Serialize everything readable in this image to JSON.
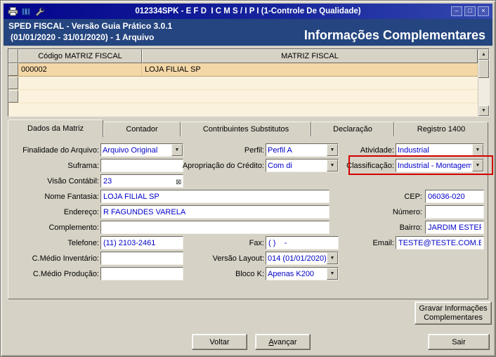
{
  "window": {
    "title": "012334SPK - E F D  I C M S / I P I (1-Controle De Qualidade)",
    "controls": {
      "minimize": "–",
      "maximize": "□",
      "close": "×"
    }
  },
  "header": {
    "line1": "SPED FISCAL - Versão Guia Prático 3.0.1",
    "line2": "(01/01/2020 - 31/01/2020) - 1 Arquivo",
    "right_title": "Informações Complementares"
  },
  "grid": {
    "columns": [
      "Código MATRIZ FISCAL",
      "MATRIZ FISCAL"
    ],
    "rows": [
      {
        "codigo": "000002",
        "matriz": "LOJA FILIAL SP"
      }
    ]
  },
  "tabs": [
    {
      "label": "Dados da Matriz",
      "active": true
    },
    {
      "label": "Contador",
      "active": false
    },
    {
      "label": "Contribuintes Substitutos",
      "active": false
    },
    {
      "label": "Declaração",
      "active": false
    },
    {
      "label": "Registro 1400",
      "active": false
    }
  ],
  "form": {
    "finalidade": {
      "label": "Finalidade do Arquivo:",
      "value": "Arquivo Original"
    },
    "suframa": {
      "label": "Suframa:",
      "value": ""
    },
    "visao_contabil": {
      "label": "Visão Contábil:",
      "value": "23"
    },
    "nome_fantasia": {
      "label": "Nome Fantasia:",
      "value": "LOJA FILIAL SP"
    },
    "endereco": {
      "label": "Endereço:",
      "value": "R FAGUNDES VARELA"
    },
    "complemento": {
      "label": "Complemento:",
      "value": ""
    },
    "telefone": {
      "label": "Telefone:",
      "value": "(11) 2103-2461"
    },
    "cmedio_inventario": {
      "label": "C.Médio Inventário:",
      "value": ""
    },
    "cmedio_producao": {
      "label": "C.Médio Produção:",
      "value": ""
    },
    "perfil": {
      "label": "Perfil:",
      "value": "Perfil A"
    },
    "apropriacao": {
      "label": "Apropriação do Crédito:",
      "value": "Com di"
    },
    "fax": {
      "label": "Fax:",
      "value": "( )    -"
    },
    "versao_layout": {
      "label": "Versão Layout:",
      "value": "014 (01/01/2020)"
    },
    "bloco_k": {
      "label": "Bloco K:",
      "value": "Apenas K200"
    },
    "atividade": {
      "label": "Atividade:",
      "value": "Industrial"
    },
    "classificacao": {
      "label": "Classificação:",
      "value": "Industrial - Montagem"
    },
    "cep": {
      "label": "CEP:",
      "value": "06036-020"
    },
    "numero": {
      "label": "Número:",
      "value": ""
    },
    "bairro": {
      "label": "Bairro:",
      "value": "JARDIM ESTER"
    },
    "email": {
      "label": "Email:",
      "value": "TESTE@TESTE.COM.BR"
    }
  },
  "buttons": {
    "gravar_line1": "Gravar Informações",
    "gravar_line2": "Complementares",
    "voltar": "Voltar",
    "avancar": "Avançar",
    "sair": "Sair"
  },
  "icons": {
    "dropdown": "▼",
    "scroll_up": "▲",
    "scroll_down": "▼",
    "clear_box": "⊠"
  },
  "colors": {
    "titlebar_blue": "#04058d",
    "header_blue": "#24457f",
    "highlight_red": "#d40000",
    "field_text_blue": "#0000c8",
    "grid_selected_row": "#f4d7a7",
    "grid_background": "#fbf2dd"
  }
}
